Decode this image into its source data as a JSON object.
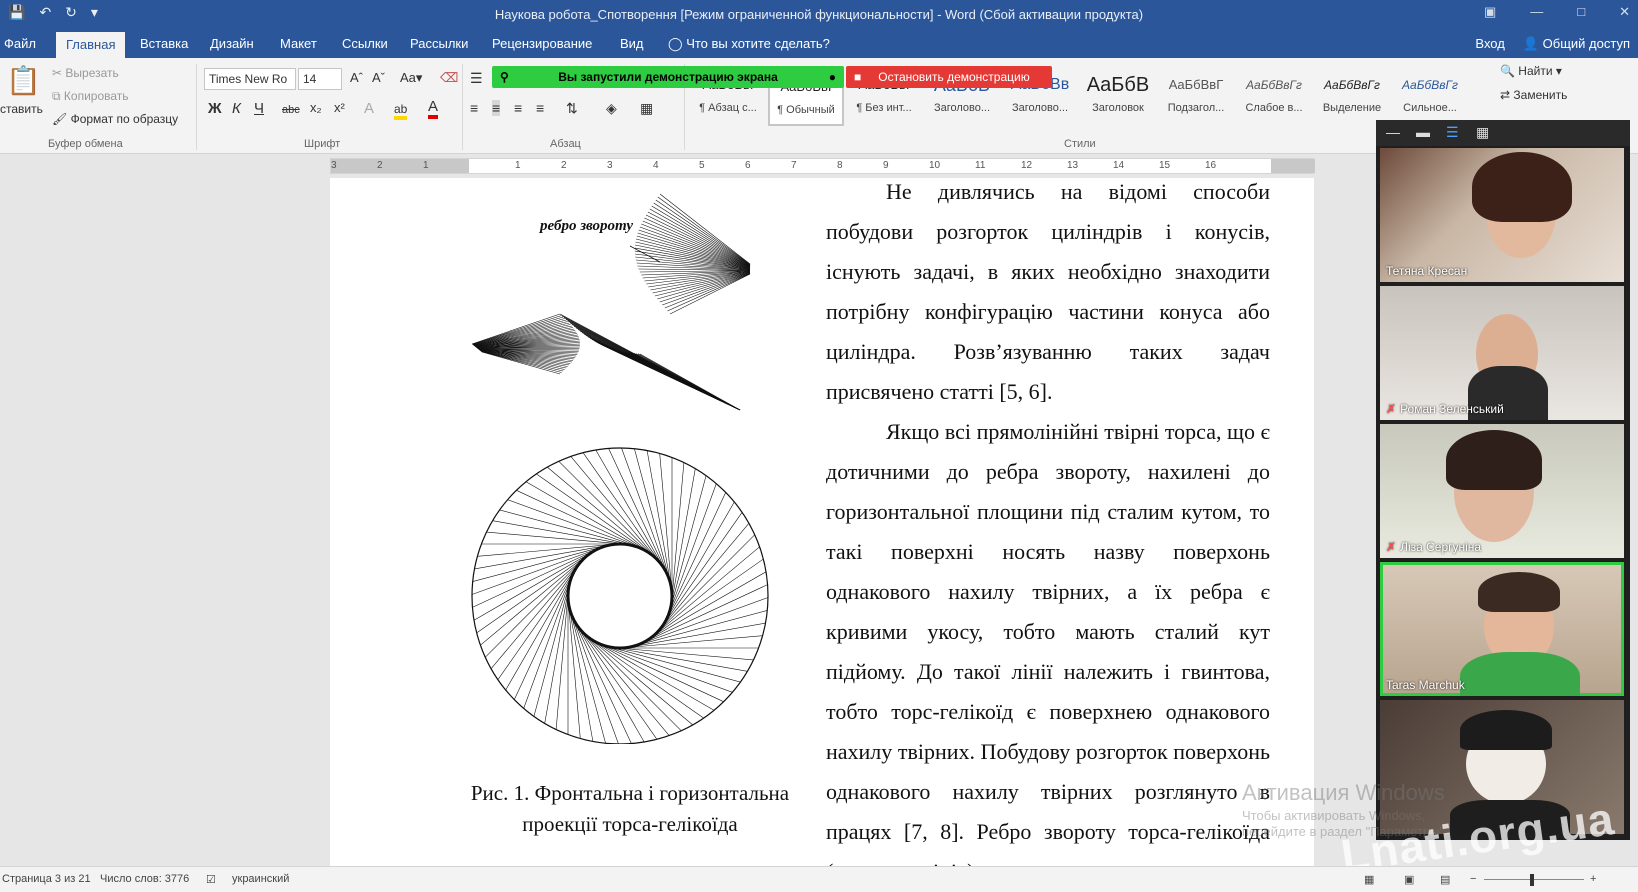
{
  "titlebar": {
    "title": "Наукова робота_Спотворення [Режим ограниченной функциональности] - Word (Сбой активации продукта)"
  },
  "tabs": {
    "items": [
      "Файл",
      "Главная",
      "Вставка",
      "Дизайн",
      "Макет",
      "Ссылки",
      "Рассылки",
      "Рецензирование",
      "Вид"
    ],
    "active": "Главная",
    "tell_me": "Что вы хотите сделать?",
    "signin": "Вход",
    "share": "Общий доступ"
  },
  "ribbon": {
    "clipboard": {
      "paste": "ставить",
      "cut": "Вырезать",
      "copy": "Копировать",
      "format_painter": "Формат по образцу",
      "label": "Буфер обмена"
    },
    "font": {
      "name": "Times New Ro",
      "size": "14",
      "label": "Шрифт"
    },
    "paragraph": {
      "label": "Абзац"
    },
    "styles": {
      "label": "Стили",
      "items": [
        {
          "preview": "AaБбВвІ",
          "name": "¶ Абзац с..."
        },
        {
          "preview": "AaБбВвІ",
          "name": "¶ Обычный"
        },
        {
          "preview": "AaБбВвІ",
          "name": "¶ Без инт..."
        },
        {
          "preview": "AaБбВ",
          "name": "Заголово..."
        },
        {
          "preview": "AaБбВв",
          "name": "Заголово..."
        },
        {
          "preview": "AaБбВ",
          "name": "Заголовок"
        },
        {
          "preview": "AaБбВвГ",
          "name": "Подзагол..."
        },
        {
          "preview": "AaБбВвГг",
          "name": "Слабое в..."
        },
        {
          "preview": "AaБбВвГг",
          "name": "Выделение"
        },
        {
          "preview": "AaБбВвГг",
          "name": "Сильное..."
        }
      ]
    },
    "editing": {
      "find": "Найти",
      "replace": "Заменить"
    }
  },
  "share_banner": {
    "started": "Вы запустили демонстрацию экрана",
    "stop": "Остановить демонстрацию"
  },
  "ruler": {
    "numbers": [
      "3",
      "2",
      "1",
      "1",
      "2",
      "3",
      "4",
      "5",
      "6",
      "7",
      "8",
      "9",
      "10",
      "11",
      "12",
      "13",
      "14",
      "15",
      "16"
    ]
  },
  "document": {
    "figure_label": "ребро звороту",
    "figure_caption": "Рис. 1. Фронтальна і горизонтальна проекції торса-гелікоїда",
    "paragraphs": [
      "Не дивлячись на відомі способи побудови розгорток циліндрів і конусів, існують задачі, в яких необхідно знаходити потрібну конфігурацію частини конуса або циліндра. Розв’язуванню таких задач присвячено статті [5, 6].",
      "Якщо всі прямолінійні твірні торса, що є дотичними до ребра звороту, нахилені до горизонтальної площини під сталим кутом, то такі поверхні носять назву поверхонь однакового нахилу твірних, а їх ребра є кривими укосу, тобто мають сталий кут підйому. До такої лінії належить і гвинтова, тобто торс-гелікоїд є поверхнею однакового нахилу твірних. Побудову розгорток поверхонь однакового нахилу твірних розглянуто в працях [7, 8]. Ребро звороту торса-гелікоїда (гвинтова лінія)"
    ]
  },
  "statusbar": {
    "page": "Страница 3 из 21",
    "words": "Число слов: 3776",
    "language": "украинский"
  },
  "watermark": {
    "title": "Активация Windows",
    "sub": "Чтобы активировать Windows, перейдите в раздел \"Параметры\".",
    "site": "Lnati.org.ua"
  },
  "participants": [
    {
      "name": "Тетяна Кресан",
      "muted": false
    },
    {
      "name": "Роман Зеленський",
      "muted": true
    },
    {
      "name": "Ліза Сергуніна",
      "muted": true
    },
    {
      "name": "Taras Marchuk",
      "muted": false
    },
    {
      "name": "",
      "muted": false
    }
  ]
}
